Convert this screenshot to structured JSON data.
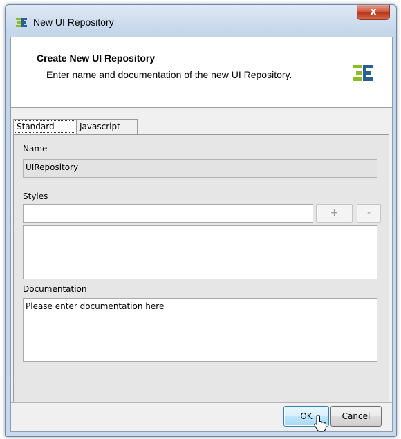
{
  "window": {
    "title": "New UI Repository",
    "close_glyph": "x"
  },
  "header": {
    "title": "Create New UI Repository",
    "description": "Enter name and documentation of the new UI Repository.",
    "logo_icon": "app-logo-icon"
  },
  "tabs": [
    {
      "label": "Standard",
      "selected": true
    },
    {
      "label": "Javascript",
      "selected": false
    }
  ],
  "form": {
    "name_label": "Name",
    "name_value": "UIRepository",
    "styles_label": "Styles",
    "styles_input_value": "",
    "add_label": "+",
    "remove_label": "-",
    "documentation_label": "Documentation",
    "documentation_value": "Please enter documentation here"
  },
  "buttons": {
    "ok_label": "OK",
    "cancel_label": "Cancel"
  },
  "colors": {
    "logo_green": "#8fba2c",
    "logo_blue": "#2b5f8e",
    "close_red": "#c9523a"
  }
}
